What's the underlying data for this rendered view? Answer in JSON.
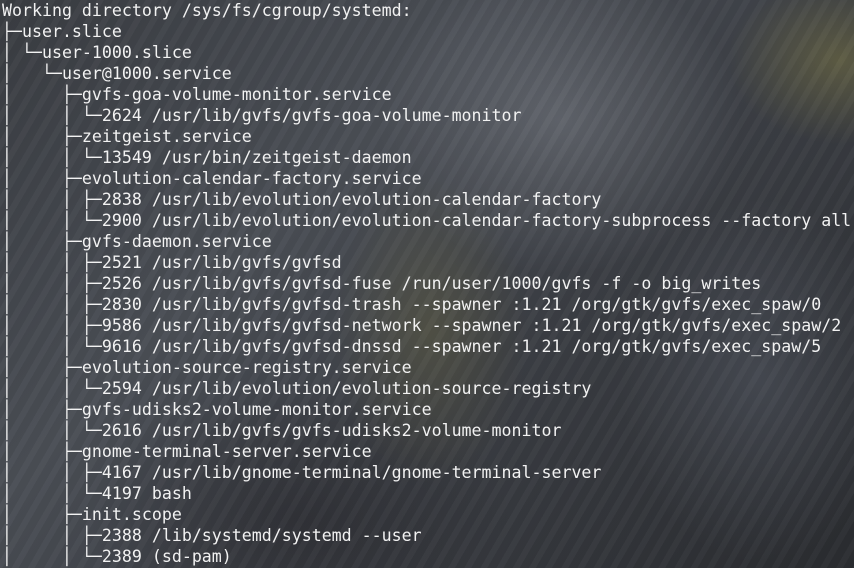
{
  "terminal": {
    "lines": [
      "Working directory /sys/fs/cgroup/systemd:",
      "├─user.slice",
      "│ └─user-1000.slice",
      "│   └─user@1000.service",
      "│     ├─gvfs-goa-volume-monitor.service",
      "│     │ └─2624 /usr/lib/gvfs/gvfs-goa-volume-monitor",
      "│     ├─zeitgeist.service",
      "│     │ └─13549 /usr/bin/zeitgeist-daemon",
      "│     ├─evolution-calendar-factory.service",
      "│     │ ├─2838 /usr/lib/evolution/evolution-calendar-factory",
      "│     │ └─2900 /usr/lib/evolution/evolution-calendar-factory-subprocess --factory all",
      "│     ├─gvfs-daemon.service",
      "│     │ ├─2521 /usr/lib/gvfs/gvfsd",
      "│     │ ├─2526 /usr/lib/gvfs/gvfsd-fuse /run/user/1000/gvfs -f -o big_writes",
      "│     │ ├─2830 /usr/lib/gvfs/gvfsd-trash --spawner :1.21 /org/gtk/gvfs/exec_spaw/0",
      "│     │ ├─9586 /usr/lib/gvfs/gvfsd-network --spawner :1.21 /org/gtk/gvfs/exec_spaw/2",
      "│     │ └─9616 /usr/lib/gvfs/gvfsd-dnssd --spawner :1.21 /org/gtk/gvfs/exec_spaw/5",
      "│     ├─evolution-source-registry.service",
      "│     │ └─2594 /usr/lib/evolution/evolution-source-registry",
      "│     ├─gvfs-udisks2-volume-monitor.service",
      "│     │ └─2616 /usr/lib/gvfs/gvfs-udisks2-volume-monitor",
      "│     ├─gnome-terminal-server.service",
      "│     │ ├─4167 /usr/lib/gnome-terminal/gnome-terminal-server",
      "│     │ └─4197 bash",
      "│     ├─init.scope",
      "│     │ ├─2388 /lib/systemd/systemd --user",
      "│     │ └─2389 (sd-pam)"
    ]
  }
}
